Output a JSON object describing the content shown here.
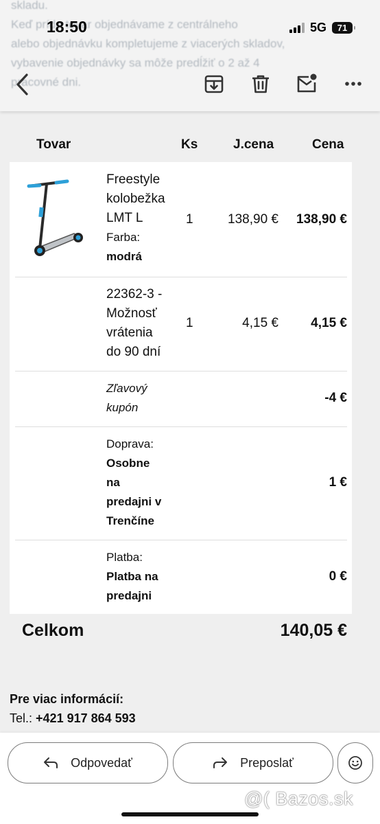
{
  "status": {
    "time": "18:50",
    "network": "5G",
    "battery": "71"
  },
  "header": {
    "background_text": [
      "skladu.",
      "Keď príde tovar objednávame z centrálneho",
      "alebo objednávku kompletujeme z viacerých skladov,",
      "vybavenie objednávky sa môže predĺžiť o 2 až 4",
      "pracovné dni."
    ],
    "icons": [
      "back-arrow-icon",
      "archive-icon",
      "trash-icon",
      "mail-unread-icon",
      "more-icon"
    ]
  },
  "table": {
    "headers": {
      "product": "Tovar",
      "qty": "Ks",
      "unit_price": "J.cena",
      "price": "Cena"
    },
    "rows": [
      {
        "name_lines": [
          "Freestyle",
          "kolobežka",
          "LMT L"
        ],
        "attr_label": "Farba:",
        "attr_value": "modrá",
        "qty": "1",
        "unit_price": "138,90 €",
        "price": "138,90 €"
      },
      {
        "name_lines": [
          "22362-3 -",
          "Možnosť",
          "vrátenia",
          "do 90 dní"
        ],
        "qty": "1",
        "unit_price": "4,15 €",
        "price": "4,15 €"
      },
      {
        "name_lines": [
          "Zľavový",
          "kupón"
        ],
        "price": "-4 €"
      },
      {
        "label": "Doprava:",
        "value_lines": [
          "Osobne",
          "na",
          "predajni v",
          "Trenčíne"
        ],
        "price": "1 €"
      },
      {
        "label": "Platba:",
        "value_lines": [
          "Platba na",
          "predajni"
        ],
        "price": "0 €"
      }
    ],
    "total_label": "Celkom",
    "total_value": "140,05 €"
  },
  "info": {
    "title": "Pre viac informácií:",
    "tel_label": "Tel.:",
    "tel_value": "+421 917 864 593"
  },
  "actions": {
    "reply": "Odpovedať",
    "forward": "Preposlať"
  },
  "watermark": "@( Bazos.sk"
}
